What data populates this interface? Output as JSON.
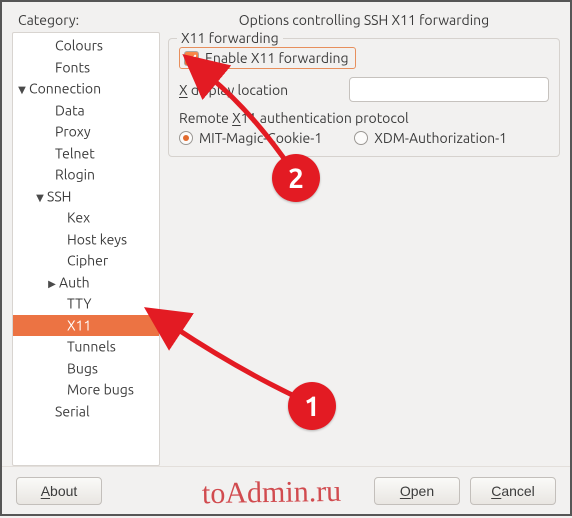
{
  "category_label": "Category:",
  "panel_title": "Options controlling SSH X11 forwarding",
  "tree": [
    {
      "label": "Colours",
      "indent": 42,
      "expander": "",
      "selected": false
    },
    {
      "label": "Fonts",
      "indent": 42,
      "expander": "",
      "selected": false
    },
    {
      "label": "Connection",
      "indent": 16,
      "expander": "▼",
      "selected": false
    },
    {
      "label": "Data",
      "indent": 42,
      "expander": "",
      "selected": false
    },
    {
      "label": "Proxy",
      "indent": 42,
      "expander": "",
      "selected": false
    },
    {
      "label": "Telnet",
      "indent": 42,
      "expander": "",
      "selected": false
    },
    {
      "label": "Rlogin",
      "indent": 42,
      "expander": "",
      "selected": false
    },
    {
      "label": "SSH",
      "indent": 34,
      "expander": "▼",
      "selected": false
    },
    {
      "label": "Kex",
      "indent": 54,
      "expander": "",
      "selected": false
    },
    {
      "label": "Host keys",
      "indent": 54,
      "expander": "",
      "selected": false
    },
    {
      "label": "Cipher",
      "indent": 54,
      "expander": "",
      "selected": false
    },
    {
      "label": "Auth",
      "indent": 46,
      "expander": "▶",
      "selected": false
    },
    {
      "label": "TTY",
      "indent": 54,
      "expander": "",
      "selected": false
    },
    {
      "label": "X11",
      "indent": 54,
      "expander": "",
      "selected": true
    },
    {
      "label": "Tunnels",
      "indent": 54,
      "expander": "",
      "selected": false
    },
    {
      "label": "Bugs",
      "indent": 54,
      "expander": "",
      "selected": false
    },
    {
      "label": "More bugs",
      "indent": 54,
      "expander": "",
      "selected": false
    },
    {
      "label": "Serial",
      "indent": 42,
      "expander": "",
      "selected": false
    }
  ],
  "x11": {
    "fieldset_title": "X11 forwarding",
    "enable_prefix": "E",
    "enable_suffix": "nable X11 forwarding",
    "enable_checked": true,
    "display_prefix": "X",
    "display_middle": " display location",
    "display_value": "",
    "proto_prefix": "Remote",
    "proto_underline": "X",
    "proto_suffix": "11 authentication protocol",
    "radios": [
      {
        "label": "MIT-Magic-Cookie-1",
        "checked": true
      },
      {
        "label": "XDM-Authorization-1",
        "checked": false
      }
    ]
  },
  "buttons": {
    "about_prefix": "A",
    "about_suffix": "bout",
    "open_prefix": "O",
    "open_suffix": "pen",
    "cancel_prefix": "C",
    "cancel_suffix": "ancel"
  },
  "annotations": {
    "badge1": "1",
    "badge2": "2",
    "watermark": "toAdmin.ru"
  }
}
